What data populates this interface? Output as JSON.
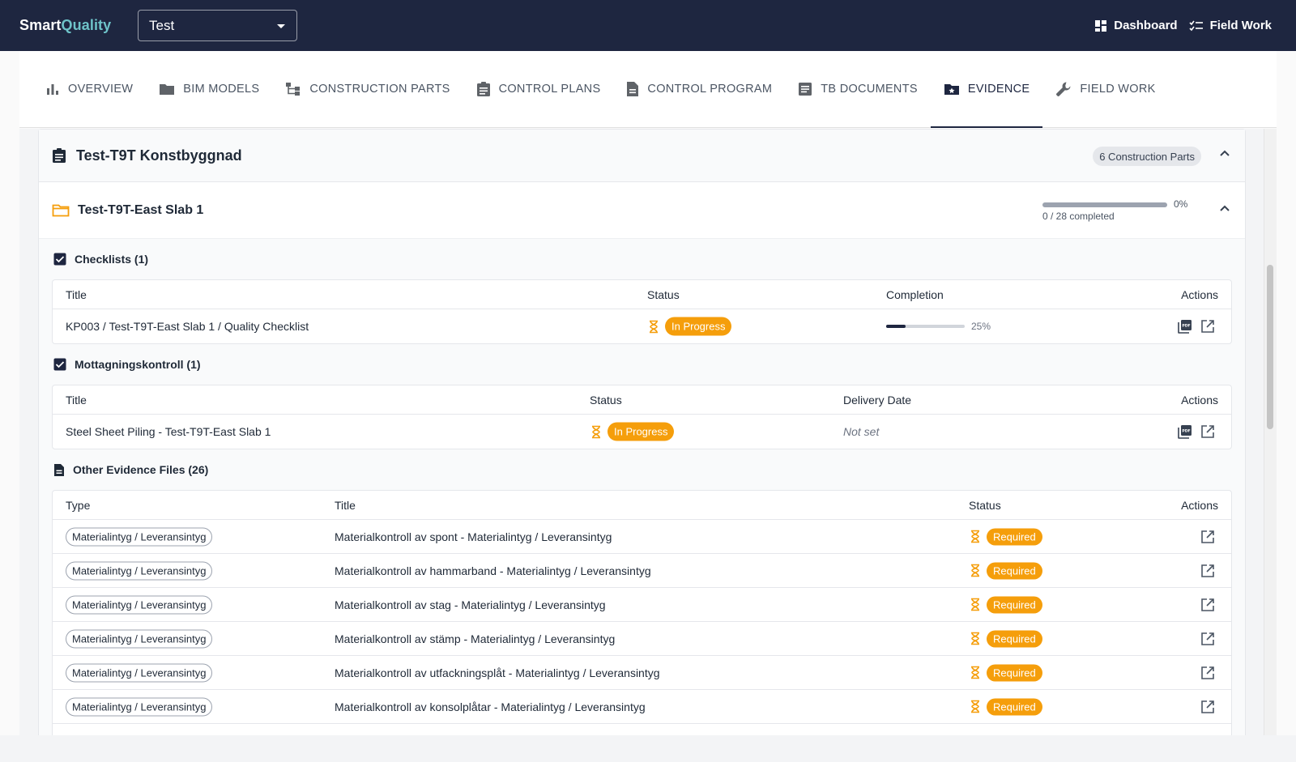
{
  "app": {
    "brand_prefix": "Smart",
    "brand_suffix": "Quality",
    "project_select_value": "Test",
    "topnav": [
      {
        "label": "Dashboard",
        "icon": "dashboard-icon"
      },
      {
        "label": "Field Work",
        "icon": "checklist-icon"
      }
    ],
    "colors": {
      "appbar": "#1e2640",
      "brand_accent": "#6ec3c9",
      "status_orange": "#f59e0b"
    }
  },
  "tabs": [
    {
      "label": "OVERVIEW",
      "icon": "bar-chart-icon"
    },
    {
      "label": "BIM MODELS",
      "icon": "folder-icon"
    },
    {
      "label": "CONSTRUCTION PARTS",
      "icon": "hierarchy-icon"
    },
    {
      "label": "CONTROL PLANS",
      "icon": "clipboard-icon"
    },
    {
      "label": "CONTROL PROGRAM",
      "icon": "document-icon"
    },
    {
      "label": "TB DOCUMENTS",
      "icon": "article-icon"
    },
    {
      "label": "EVIDENCE",
      "icon": "folder-star-icon",
      "active": true
    },
    {
      "label": "FIELD WORK",
      "icon": "wrench-icon"
    }
  ],
  "plan": {
    "title": "Test-T9T Konstbyggnad",
    "parts_chip": "6 Construction Parts"
  },
  "part": {
    "title": "Test-T9T-East Slab 1",
    "progress_pct": "0%",
    "progress_value": 0,
    "progress_count": "0 / 28 completed"
  },
  "checklists": {
    "title": "Checklists (1)",
    "headers": {
      "title": "Title",
      "status": "Status",
      "completion": "Completion",
      "actions": "Actions"
    },
    "rows": [
      {
        "title": "KP003 / Test-T9T-East Slab 1 / Quality Checklist",
        "status": "In Progress",
        "completion_pct": "25%",
        "completion_value": 25
      }
    ]
  },
  "mottagning": {
    "title": "Mottagningskontroll (1)",
    "headers": {
      "title": "Title",
      "status": "Status",
      "delivery": "Delivery Date",
      "actions": "Actions"
    },
    "rows": [
      {
        "title": "Steel Sheet Piling - Test-T9T-East Slab 1",
        "status": "In Progress",
        "delivery": "Not set"
      }
    ]
  },
  "other": {
    "title": "Other Evidence Files (26)",
    "headers": {
      "type": "Type",
      "title": "Title",
      "status": "Status",
      "actions": "Actions"
    },
    "rows": [
      {
        "type": "Materialintyg / Leveransintyg",
        "title": "Materialkontroll av spont - Materialintyg / Leveransintyg",
        "status": "Required"
      },
      {
        "type": "Materialintyg / Leveransintyg",
        "title": "Materialkontroll av hammarband - Materialintyg / Leveransintyg",
        "status": "Required"
      },
      {
        "type": "Materialintyg / Leveransintyg",
        "title": "Materialkontroll av stag - Materialintyg / Leveransintyg",
        "status": "Required"
      },
      {
        "type": "Materialintyg / Leveransintyg",
        "title": "Materialkontroll av stämp - Materialintyg / Leveransintyg",
        "status": "Required"
      },
      {
        "type": "Materialintyg / Leveransintyg",
        "title": "Materialkontroll av utfackningsplåt - Materialintyg / Leveransintyg",
        "status": "Required"
      },
      {
        "type": "Materialintyg / Leveransintyg",
        "title": "Materialkontroll av konsolplåtar - Materialintyg / Leveransintyg",
        "status": "Required"
      }
    ]
  }
}
